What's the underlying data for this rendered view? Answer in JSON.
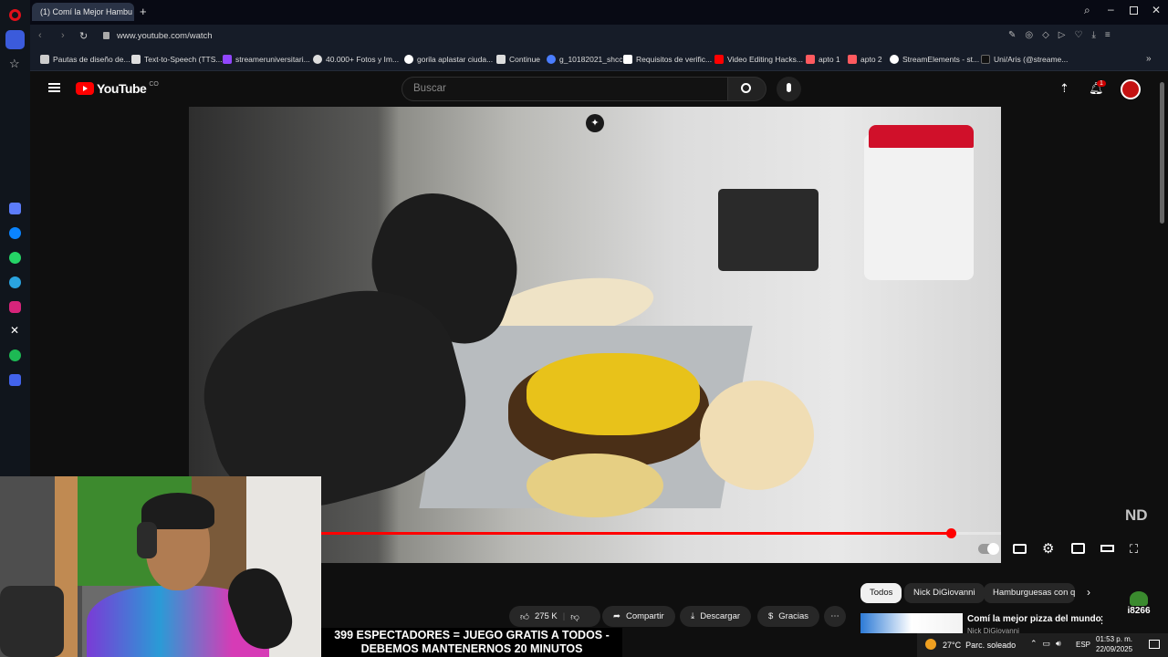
{
  "browser": {
    "tab_title": "(1) Comí la Mejor Hambu",
    "url": "www.youtube.com/watch",
    "bookmarks": [
      "Pautas de diseño de...",
      "Text-to-Speech (TTS...",
      "streameruniversitari...",
      "40.000+ Fotos y Im...",
      "gorila aplastar ciuda...",
      "Continue",
      "g_10182021_shcc",
      "Requisitos de verific...",
      "Video Editing Hacks...",
      "apto 1",
      "apto 2",
      "StreamElements - st...",
      "Uni/Aris (@streame..."
    ]
  },
  "youtube": {
    "logo_text": "YouTube",
    "logo_country": "CO",
    "search_placeholder": "Buscar",
    "notification_count": "1",
    "watermark": "ND",
    "progress_fraction": 0.926,
    "chips": [
      "Todos",
      "Nick DiGiovanni",
      "Hamburguesas con q"
    ],
    "actions": {
      "likes": "275 K",
      "share": "Compartir",
      "download": "Descargar",
      "thanks": "Gracias"
    },
    "recommended": {
      "title": "Comí la mejor pizza del mundo",
      "channel": "Nick DiGiovanni"
    }
  },
  "overlay": {
    "caption_line1": "399 ESPECTADORES = JUEGO GRATIS A TODOS -",
    "caption_line2": "DEBEMOS MANTENERNOS 20 MINUTOS",
    "badge": "i8266"
  },
  "taskbar": {
    "weather": "27°C  Parc. soleado",
    "lang": "ESP",
    "time": "01:53 p. m.",
    "date": "22/09/2025"
  },
  "colors": {
    "accent_red": "#ff0000",
    "bg": "#0f0f0f",
    "chip_bg": "#272727",
    "browser_bg": "#161c28"
  }
}
